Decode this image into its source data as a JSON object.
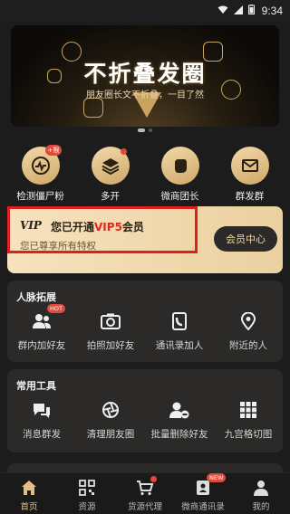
{
  "status_bar": {
    "time": "9:34"
  },
  "banner": {
    "title": "不折叠发圈",
    "subtitle": "朋友圈长文不折叠，一目了然"
  },
  "quick_actions": [
    {
      "label": "检测僵尸粉",
      "icon": "pulse-icon",
      "badge": "+限"
    },
    {
      "label": "多开",
      "icon": "layers-icon"
    },
    {
      "label": "微商团长",
      "icon": "fist-icon"
    },
    {
      "label": "群发群",
      "icon": "mail-icon"
    }
  ],
  "vip": {
    "logo": "VIP",
    "status_prefix": "您已开通",
    "status_level": "VIP5",
    "status_suffix": "会员",
    "privilege_text": "您已尊享所有特权",
    "center_button": "会员中心"
  },
  "network": {
    "title": "人脉拓展",
    "items": [
      {
        "label": "群内加好友",
        "icon": "group-icon",
        "badge": "HOT"
      },
      {
        "label": "拍照加好友",
        "icon": "camera-icon"
      },
      {
        "label": "通讯录加人",
        "icon": "phone-book-icon"
      },
      {
        "label": "附近的人",
        "icon": "location-icon"
      }
    ]
  },
  "tools": {
    "title": "常用工具",
    "items": [
      {
        "label": "消息群发",
        "icon": "broadcast-icon"
      },
      {
        "label": "清理朋友圈",
        "icon": "aperture-icon"
      },
      {
        "label": "批量删除好友",
        "icon": "user-remove-icon"
      },
      {
        "label": "九宫格切图",
        "icon": "grid-icon"
      }
    ]
  },
  "tabs": [
    {
      "label": "首页",
      "icon": "home-icon",
      "active": true
    },
    {
      "label": "资源",
      "icon": "qrcode-icon"
    },
    {
      "label": "货源代理",
      "icon": "cart-icon",
      "dot": true
    },
    {
      "label": "微商通讯录",
      "icon": "contacts-icon",
      "badge": "NEW"
    },
    {
      "label": "我的",
      "icon": "profile-icon"
    }
  ],
  "colors": {
    "gold": "#e2bf80",
    "vip_red": "#e0281f",
    "highlight_box": "#e01f1f"
  }
}
